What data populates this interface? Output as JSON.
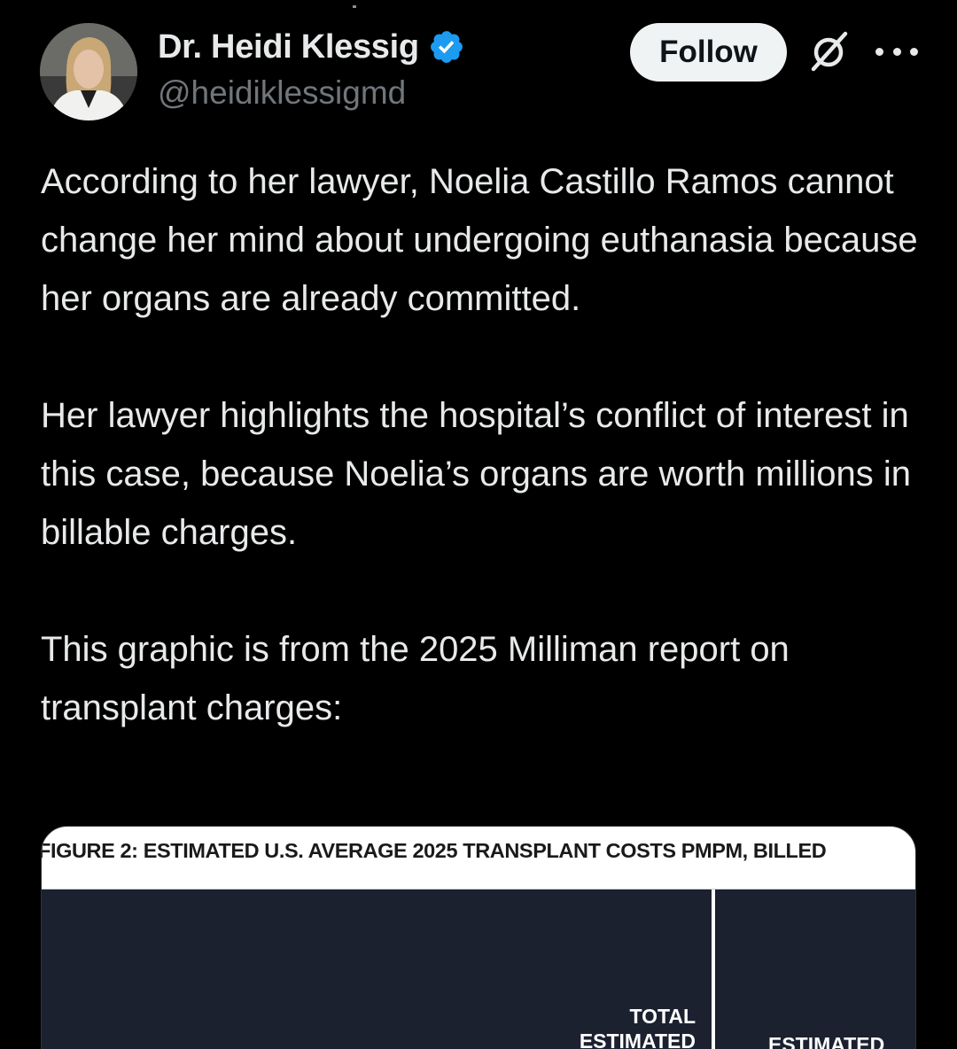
{
  "author": {
    "display_name": "Dr. Heidi Klessig",
    "handle": "@heidiklessigmd",
    "verified": true
  },
  "actions": {
    "follow_label": "Follow",
    "grok_icon": "grok-icon",
    "more_icon": "more-icon"
  },
  "tweet": {
    "paragraphs": [
      "According to her lawyer, Noelia Castillo Ramos cannot change her mind about undergoing euthanasia because her organs are already committed.",
      "Her lawyer highlights the hospital’s conflict of interest in this case, because Noelia’s organs are worth millions in billable charges.",
      "This graphic is from the 2025 Milliman report on transplant charges:"
    ]
  },
  "media": {
    "figure_title": "FIGURE 2: ESTIMATED U.S. AVERAGE 2025 TRANSPLANT COSTS PMPM, BILLED",
    "col_header_1_line1": "TOTAL",
    "col_header_1_line2": "ESTIMATED",
    "col_header_2_line1": "ESTIMATED"
  },
  "colors": {
    "background": "#000000",
    "text_primary": "#e7e9ea",
    "text_secondary": "#71767b",
    "verified_blue": "#1d9bf0",
    "follow_bg": "#eff3f4",
    "table_dark": "#1c2130"
  }
}
